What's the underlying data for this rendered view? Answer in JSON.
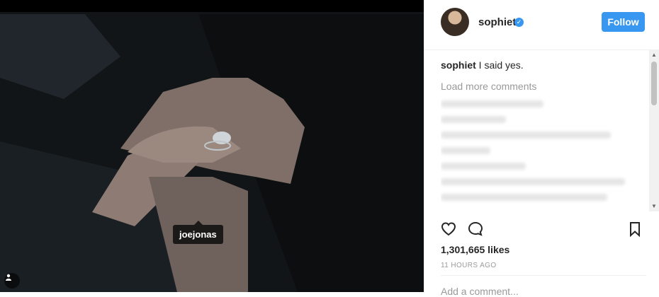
{
  "photo": {
    "tag_user": "joejonas",
    "user_icon": "person-icon"
  },
  "profile": {
    "username": "sophiet",
    "follow_label": "Follow"
  },
  "caption": {
    "username": "sophiet",
    "text": "I said yes."
  },
  "comments": {
    "load_more": "Load more comments"
  },
  "post": {
    "likes": "1,301,665 likes",
    "time": "11 HOURS AGO",
    "add_comment": "Add a comment..."
  },
  "colors": {
    "accent": "#3897f0",
    "text": "#262626",
    "muted": "#999999"
  }
}
